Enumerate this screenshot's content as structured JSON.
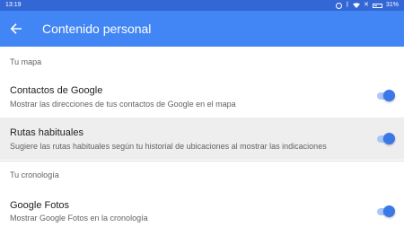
{
  "status_bar": {
    "time": "13:19",
    "battery": "31%"
  },
  "app_bar": {
    "title": "Contenido personal"
  },
  "sections": [
    {
      "header": "Tu mapa"
    },
    {
      "header": "Tu cronología"
    }
  ],
  "settings": [
    {
      "title": "Contactos de Google",
      "description": "Mostrar las direcciones de tus contactos de Google en el mapa",
      "enabled": true
    },
    {
      "title": "Rutas habituales",
      "description": "Sugiere las rutas habituales según tu historial de ubicaciones al mostrar las indicaciones",
      "enabled": true
    },
    {
      "title": "Google Fotos",
      "description": "Mostrar Google Fotos en la cronología",
      "enabled": true
    }
  ],
  "colors": {
    "status_bar": "#3367d6",
    "app_bar": "#4285f4",
    "highlight_row": "#eeeeee",
    "toggle_on": "#3b78e7"
  }
}
